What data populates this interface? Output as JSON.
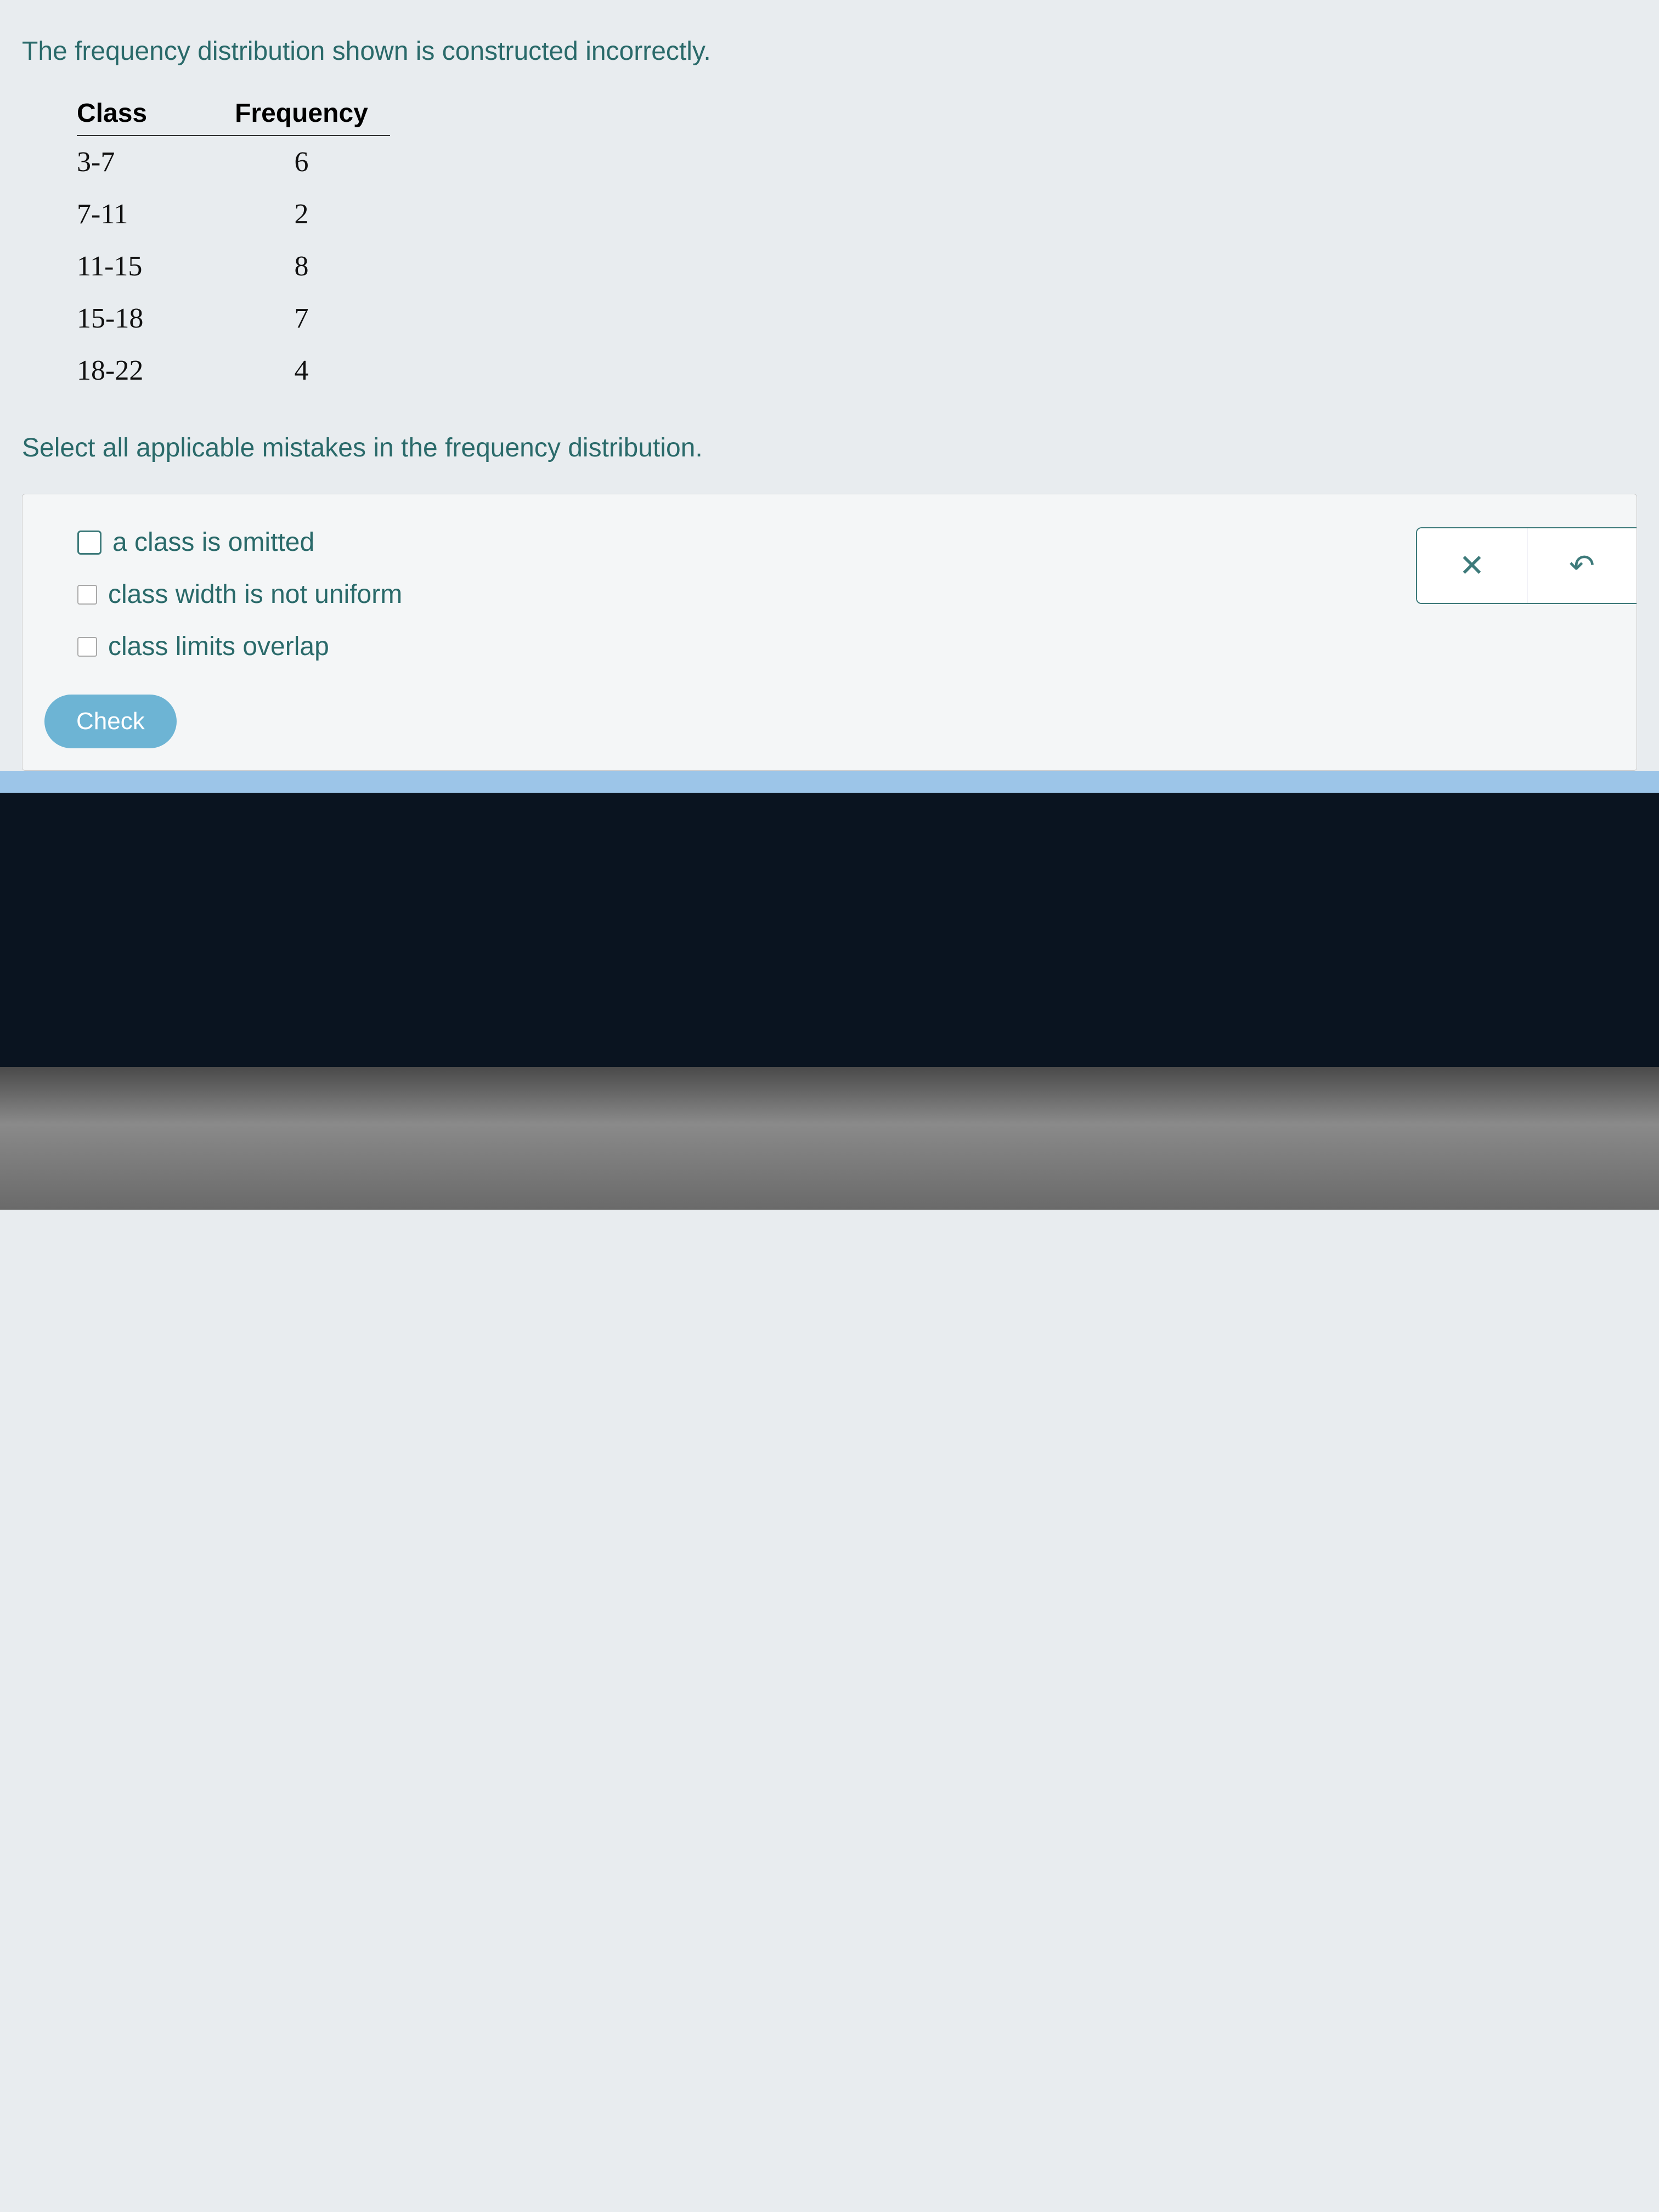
{
  "prompt": "The frequency distribution shown is constructed incorrectly.",
  "table": {
    "headers": {
      "class": "Class",
      "frequency": "Frequency"
    },
    "rows": [
      {
        "class": "3-7",
        "frequency": "6"
      },
      {
        "class": "7-11",
        "frequency": "2"
      },
      {
        "class": "11-15",
        "frequency": "8"
      },
      {
        "class": "15-18",
        "frequency": "7"
      },
      {
        "class": "18-22",
        "frequency": "4"
      }
    ]
  },
  "instruction": "Select all applicable mistakes in the frequency distribution.",
  "options": {
    "opt0": "a class is omitted",
    "opt1": "class width is not uniform",
    "opt2": "class limits overlap"
  },
  "toolbar": {
    "clear_glyph": "✕",
    "reset_glyph": "↶"
  },
  "buttons": {
    "check": "Check"
  }
}
